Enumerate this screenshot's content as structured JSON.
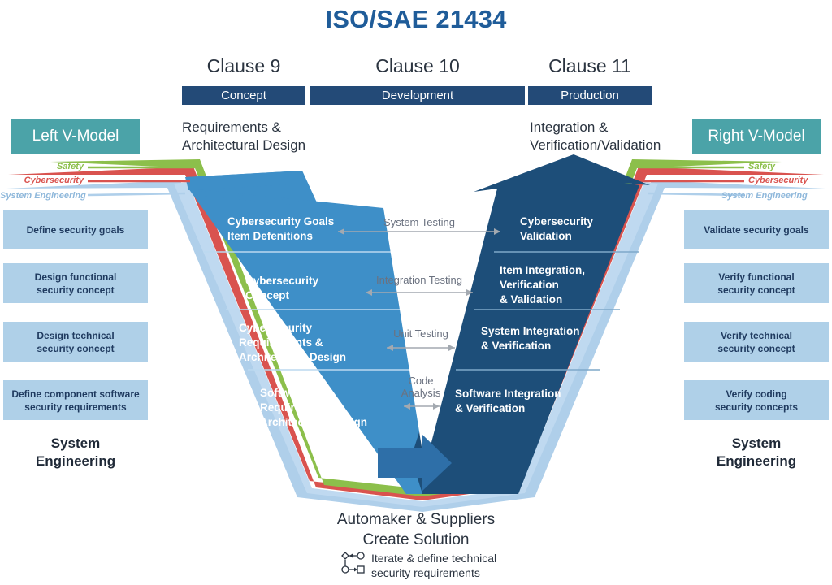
{
  "title": "ISO/SAE 21434",
  "clauses": [
    {
      "name": "Clause 9",
      "phase": "Concept"
    },
    {
      "name": "Clause 10",
      "phase": "Development"
    },
    {
      "name": "Clause 11",
      "phase": "Production"
    }
  ],
  "phase_headings": {
    "left_line1": "Requirements &",
    "left_line2": "Architectural Design",
    "right_line1": "Integration &",
    "right_line2": "Verification/Validation"
  },
  "badges": {
    "left": "Left V-Model",
    "right": "Right V-Model"
  },
  "legend": [
    {
      "label": "Safety",
      "color": "#8CBF4B"
    },
    {
      "label": "Cybersecurity",
      "color": "#D9534F"
    },
    {
      "label": "System Engineering",
      "color": "#8FB8DB"
    }
  ],
  "left_boxes": [
    "Define security goals",
    "Design functional\nsecurity concept",
    "Design technical\nsecurity concept",
    "Define component software\nsecurity requirements"
  ],
  "right_boxes": [
    "Validate security goals",
    "Verify functional\nsecurity concept",
    "Verify technical\nsecurity concept",
    "Verify coding\nsecurity concepts"
  ],
  "left_footer": "System\nEngineering",
  "right_footer": "System\nEngineering",
  "left_arm": [
    "Cybersecurity Goals\nItem Defenitions",
    "Cybersecurity\nConcept",
    "Cybersecurity\nRequirements &\nArchitectural Design",
    "Software\nRequirements &\nArchitectural Design"
  ],
  "right_arm": [
    "Cybersecurity\nValidation",
    "Item Integration,\nVerification\n& Validation",
    "System Integration\n& Verification",
    "Software Integration\n& Verification"
  ],
  "center_tests": [
    "System Testing",
    "Integration Testing",
    "Unit Testing",
    "Code\nAnalysis"
  ],
  "bottom_caption": "Automaker & Suppliers\nCreate Solution",
  "iterate_note": "Iterate & define technical\nsecurity requirements",
  "colors": {
    "title": "#1F5C99",
    "clause_bar": "#234A77",
    "badge_teal": "#4BA3A8",
    "left_arm": "#3E8FC8",
    "right_arm": "#1D4E79",
    "side_box": "#AFD0E8",
    "safety": "#8CBF4B",
    "cybersecurity": "#D9534F",
    "system_engineering": "#8FB8DB",
    "center_arrow": "#2E6FA8"
  }
}
